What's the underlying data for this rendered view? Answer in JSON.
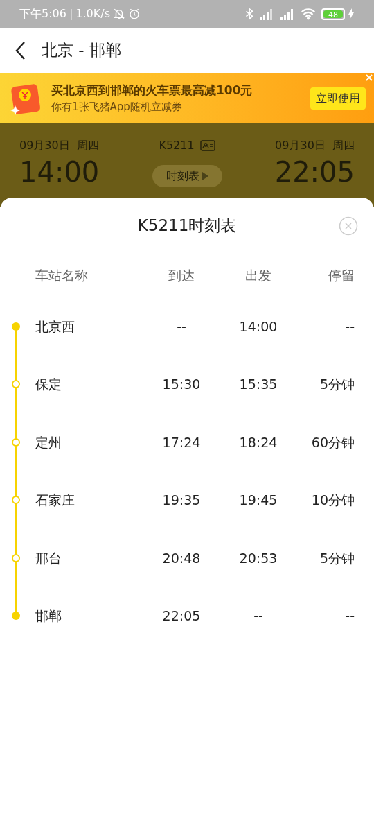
{
  "status_bar": {
    "time": "下午5:06",
    "separator": "|",
    "speed": "1.0K/s",
    "battery": "48"
  },
  "header": {
    "title": "北京 - 邯郸"
  },
  "banner": {
    "title": "买北京西到邯郸的火车票最高减100元",
    "subtitle": "你有1张飞猪App随机立减券",
    "button": "立即使用"
  },
  "trip": {
    "depart_date": "09月30日  周四",
    "train": "K5211",
    "arrive_date": "09月30日  周四",
    "depart_time": "14:00",
    "arrive_time": "22:05",
    "schedule_button": "时刻表"
  },
  "sheet": {
    "title": "K5211时刻表",
    "columns": [
      "车站名称",
      "到达",
      "出发",
      "停留"
    ],
    "stations": [
      {
        "kind": "terminal",
        "name": "北京西",
        "arrive": "--",
        "depart": "14:00",
        "stay": "--"
      },
      {
        "kind": "stop",
        "name": "保定",
        "arrive": "15:30",
        "depart": "15:35",
        "stay": "5分钟"
      },
      {
        "kind": "stop",
        "name": "定州",
        "arrive": "17:24",
        "depart": "18:24",
        "stay": "60分钟"
      },
      {
        "kind": "stop",
        "name": "石家庄",
        "arrive": "19:35",
        "depart": "19:45",
        "stay": "10分钟"
      },
      {
        "kind": "stop",
        "name": "邢台",
        "arrive": "20:48",
        "depart": "20:53",
        "stay": "5分钟"
      },
      {
        "kind": "terminal",
        "name": "邯郸",
        "arrive": "22:05",
        "depart": "--",
        "stay": "--"
      }
    ]
  }
}
